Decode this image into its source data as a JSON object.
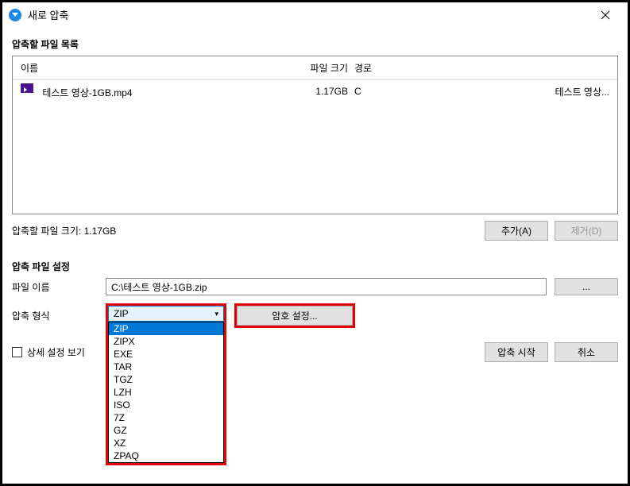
{
  "titlebar": {
    "title": "새로 압축"
  },
  "file_list": {
    "section_label": "압축할 파일 목록",
    "headers": {
      "name": "이름",
      "size": "파일 크기",
      "path": "경로"
    },
    "rows": [
      {
        "name": "테스트 영상-1GB.mp4",
        "size": "1.17GB",
        "path": "C",
        "extra": "테스트 영상..."
      }
    ],
    "total_size_label": "압축할 파일 크기: 1.17GB",
    "add_button": "추가(A)",
    "remove_button": "제거(D)"
  },
  "settings": {
    "section_label": "압축 파일 설정",
    "filename_label": "파일 이름",
    "filename_value": "C:\\테스트 영상-1GB.zip",
    "browse_button": "...",
    "format_label": "압축 형식",
    "format_selected": "ZIP",
    "format_options": [
      "ZIP",
      "ZIPX",
      "EXE",
      "TAR",
      "TGZ",
      "LZH",
      "ISO",
      "7Z",
      "GZ",
      "XZ",
      "ZPAQ"
    ],
    "password_button": "암호 설정..."
  },
  "bottom": {
    "advanced_checkbox": "상세 설정 보기",
    "start_button": "압축 시작",
    "cancel_button": "취소"
  }
}
